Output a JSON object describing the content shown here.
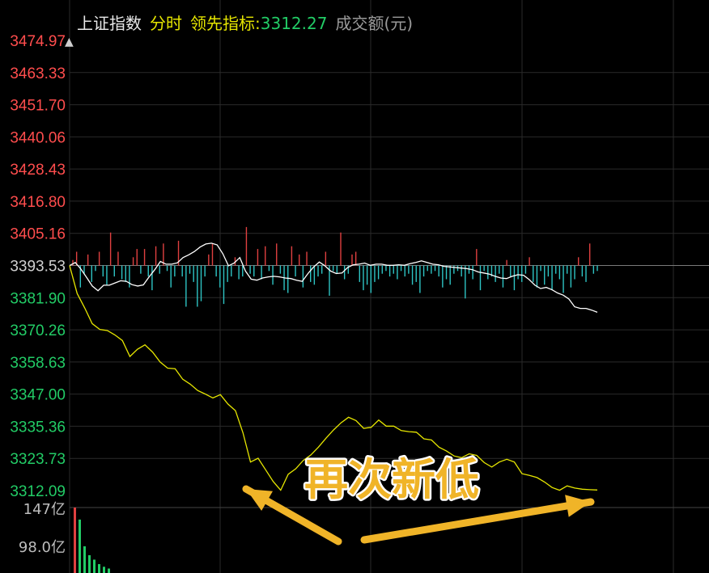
{
  "header": {
    "index_name": "上证指数",
    "mode": "分时",
    "leading_label": "领先指标:",
    "leading_value": "3312.27",
    "volume_label": "成交额(元)"
  },
  "colors": {
    "up": "#ff4d4d",
    "down": "#22cc66",
    "index_line": "#ffffff",
    "leading_line": "#e6e600",
    "volume_up": "#e04040",
    "volume_down": "#2ec4c4",
    "grid": "#2a2a2a",
    "annotation": "#f0b428"
  },
  "chart_data": {
    "type": "line",
    "y_ticks": [
      "3474.97",
      "3463.33",
      "3451.70",
      "3440.06",
      "3428.43",
      "3416.80",
      "3405.16",
      "3393.53",
      "3381.90",
      "3370.26",
      "3358.63",
      "3347.00",
      "3335.36",
      "3323.73",
      "3312.09"
    ],
    "prev_close": 3393.53,
    "ylim": [
      3312.09,
      3474.97
    ],
    "volume_ticks": [
      "147亿",
      "98.0亿"
    ],
    "series": [
      {
        "name": "上证指数",
        "values": [
          3393.5,
          3394.6,
          3392.2,
          3389.2,
          3386.1,
          3384.4,
          3386.4,
          3386.4,
          3387.2,
          3388.0,
          3387.8,
          3386.6,
          3386.1,
          3386.5,
          3389.4,
          3392.0,
          3395.0,
          3394.0,
          3394.0,
          3394.5,
          3396.4,
          3397.4,
          3398.6,
          3400.2,
          3401.3,
          3401.6,
          3401.0,
          3397.8,
          3393.4,
          3394.4,
          3396.4,
          3391.5,
          3388.6,
          3388.2,
          3389.0,
          3389.4,
          3389.6,
          3389.4,
          3389.0,
          3388.8,
          3388.2,
          3387.8,
          3390.6,
          3393.0,
          3394.8,
          3393.4,
          3391.5,
          3390.6,
          3390.8,
          3392.8,
          3393.8,
          3394.0,
          3394.4,
          3393.6,
          3394.0,
          3394.0,
          3393.6,
          3393.6,
          3393.8,
          3393.6,
          3394.2,
          3394.6,
          3395.2,
          3394.6,
          3394.0,
          3393.8,
          3393.2,
          3393.0,
          3392.8,
          3392.6,
          3392.4,
          3392.0,
          3391.2,
          3390.8,
          3390.4,
          3389.6,
          3389.0,
          3388.8,
          3389.6,
          3390.2,
          3390.0,
          3388.4,
          3386.4,
          3385.2,
          3385.6,
          3384.8,
          3383.6,
          3382.8,
          3381.4,
          3378.6,
          3378.0,
          3378.0,
          3377.4,
          3376.6
        ],
        "color": "#ffffff"
      },
      {
        "name": "领先指标",
        "values": [
          3393.5,
          3383.4,
          3378.2,
          3372.5,
          3370.4,
          3370.0,
          3368.4,
          3366.4,
          3360.6,
          3363.2,
          3364.8,
          3362.2,
          3358.6,
          3356.4,
          3356.2,
          3352.4,
          3350.6,
          3348.3,
          3347.0,
          3345.6,
          3346.8,
          3343.4,
          3341.0,
          3333.0,
          3322.4,
          3323.8,
          3319.6,
          3315.4,
          3312.2,
          3318.0,
          3320.0,
          3323.0,
          3325.0,
          3327.8,
          3331.0,
          3334.0,
          3336.6,
          3338.6,
          3337.4,
          3334.6,
          3335.0,
          3337.6,
          3335.4,
          3335.4,
          3333.8,
          3333.4,
          3333.2,
          3330.8,
          3330.4,
          3327.8,
          3326.4,
          3324.6,
          3324.0,
          3325.4,
          3324.8,
          3322.2,
          3320.6,
          3322.4,
          3323.4,
          3322.4,
          3318.2,
          3317.6,
          3316.8,
          3315.2,
          3313.2,
          3312.2,
          3313.8,
          3313.0,
          3312.6,
          3312.4,
          3312.3
        ],
        "color": "#e6e600"
      }
    ],
    "volume_diff": [
      2,
      5,
      -8,
      -3,
      4,
      -6,
      -2,
      5,
      -4,
      -7,
      12,
      -4,
      5,
      -5,
      -6,
      -8,
      3,
      6,
      -3,
      6,
      -4,
      -9,
      7,
      -3,
      8,
      -2,
      -8,
      -4,
      9,
      -4,
      -15,
      -3,
      -6,
      -15,
      -13,
      -4,
      4,
      8,
      -4,
      -8,
      -14,
      -6,
      -4,
      3,
      -5,
      -4,
      14,
      -3,
      -4,
      6,
      -5,
      7,
      -2,
      -7,
      8,
      -3,
      -9,
      -10,
      7,
      -4,
      4,
      -8,
      5,
      -6,
      -7,
      -4,
      -3,
      5,
      -11,
      -2,
      -3,
      12,
      -5,
      -3,
      4,
      5,
      -6,
      -9,
      -7,
      -10,
      -6,
      -5,
      -3,
      -2,
      -4,
      -3,
      -5,
      -2,
      -4,
      -3,
      -7,
      -6,
      -10,
      -4,
      -2,
      -3,
      -2,
      -4,
      -8,
      -5,
      -7,
      -3,
      -2,
      -4,
      -12,
      -3,
      -5,
      6,
      -9,
      -2,
      -5,
      -4,
      -6,
      -3,
      -8,
      2,
      -4,
      -9,
      -5,
      -6,
      -3,
      3,
      -6,
      -8,
      -2,
      -7,
      -4,
      -9,
      -3,
      -5,
      -10,
      -3,
      -8,
      -5,
      3,
      -4,
      -6,
      8,
      -3,
      -2
    ],
    "volume_bars": [
      147,
      120,
      60,
      40,
      30,
      20,
      14,
      10
    ],
    "annotation": "再次新低"
  }
}
